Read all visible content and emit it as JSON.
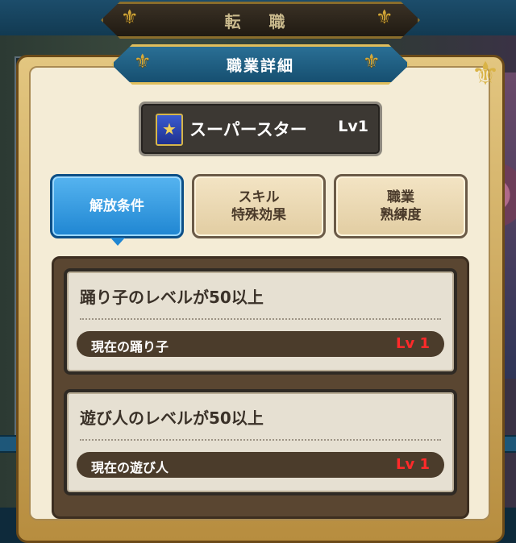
{
  "header": {
    "title": "転 職"
  },
  "panel": {
    "title": "職業詳細"
  },
  "job": {
    "icon": "superstar-emblem-icon",
    "name": "スーパースター",
    "level": "Lv1"
  },
  "tabs": [
    {
      "line1": "解放条件",
      "line2": "",
      "active": true
    },
    {
      "line1": "スキル",
      "line2": "特殊効果",
      "active": false
    },
    {
      "line1": "職業",
      "line2": "熟練度",
      "active": false
    }
  ],
  "conditions": [
    {
      "title": "踊り子のレベルが50以上",
      "status_label": "現在の踊り子",
      "status_value": "Lv 1"
    },
    {
      "title": "遊び人のレベルが50以上",
      "status_label": "現在の遊び人",
      "status_value": "Lv 1"
    }
  ],
  "colors": {
    "accent": "#1f86d2",
    "warning": "#ff2a2a",
    "gold": "#d4a93a"
  }
}
